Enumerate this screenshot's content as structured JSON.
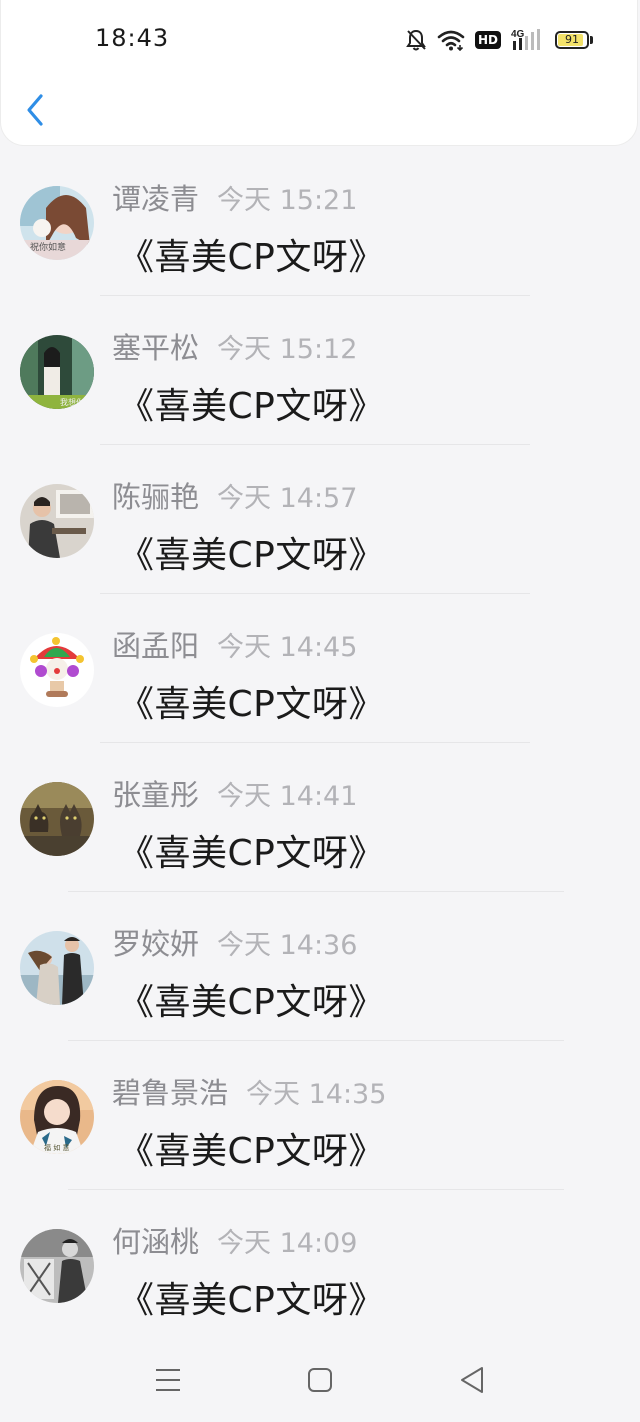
{
  "status_bar": {
    "time": "18:43",
    "hd_label": "HD",
    "network_label": "4G",
    "battery_level": "91",
    "icons": [
      "bell-off-icon",
      "wifi-icon",
      "hd-icon",
      "signal-4g-icon",
      "battery-icon"
    ]
  },
  "header": {
    "back_icon": "chevron-left-icon"
  },
  "colors": {
    "accent": "#2f8ee6",
    "name_text": "#8d8d92",
    "time_text": "#b3b3b7",
    "message_text": "#1b1b1b"
  },
  "chats": [
    {
      "name": "谭凌青",
      "time": "今天 15:21",
      "message": "《喜美CP文呀》"
    },
    {
      "name": "塞平松",
      "time": "今天 15:12",
      "message": "《喜美CP文呀》"
    },
    {
      "name": "陈骊艳",
      "time": "今天 14:57",
      "message": "《喜美CP文呀》"
    },
    {
      "name": "函孟阳",
      "time": "今天 14:45",
      "message": "《喜美CP文呀》"
    },
    {
      "name": "张童彤",
      "time": "今天 14:41",
      "message": "《喜美CP文呀》"
    },
    {
      "name": "罗姣妍",
      "time": "今天 14:36",
      "message": "《喜美CP文呀》"
    },
    {
      "name": "碧鲁景浩",
      "time": "今天 14:35",
      "message": "《喜美CP文呀》"
    },
    {
      "name": "何涵桃",
      "time": "今天 14:09",
      "message": "《喜美CP文呀》"
    }
  ],
  "nav_bar": {
    "icons": [
      "menu-icon",
      "home-icon",
      "back-triangle-icon"
    ]
  }
}
